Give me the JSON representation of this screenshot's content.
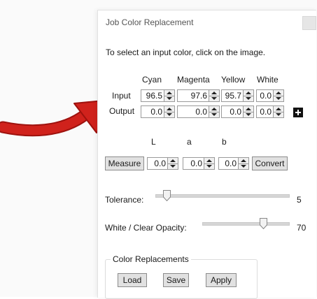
{
  "window": {
    "title": "Job Color Replacement"
  },
  "instruction": "To select an input color, click on the image.",
  "columns": [
    "Cyan",
    "Magenta",
    "Yellow",
    "White"
  ],
  "input_label": "Input",
  "output_label": "Output",
  "input_values": [
    "96.5",
    "97.6",
    "95.7",
    "0.0"
  ],
  "output_values": [
    "0.0",
    "0.0",
    "0.0",
    "0.0"
  ],
  "lab": {
    "headers": [
      "L",
      "a",
      "b"
    ],
    "values": [
      "0.0",
      "0.0",
      "0.0"
    ],
    "measure_label": "Measure",
    "convert_label": "Convert"
  },
  "tolerance": {
    "label": "Tolerance:",
    "value": "5"
  },
  "opacity": {
    "label": "White / Clear Opacity:",
    "value": "70"
  },
  "replacements": {
    "group_label": "Color Replacements",
    "load_label": "Load",
    "save_label": "Save",
    "apply_label": "Apply"
  },
  "colors": {
    "arrow": "#d0221c"
  }
}
